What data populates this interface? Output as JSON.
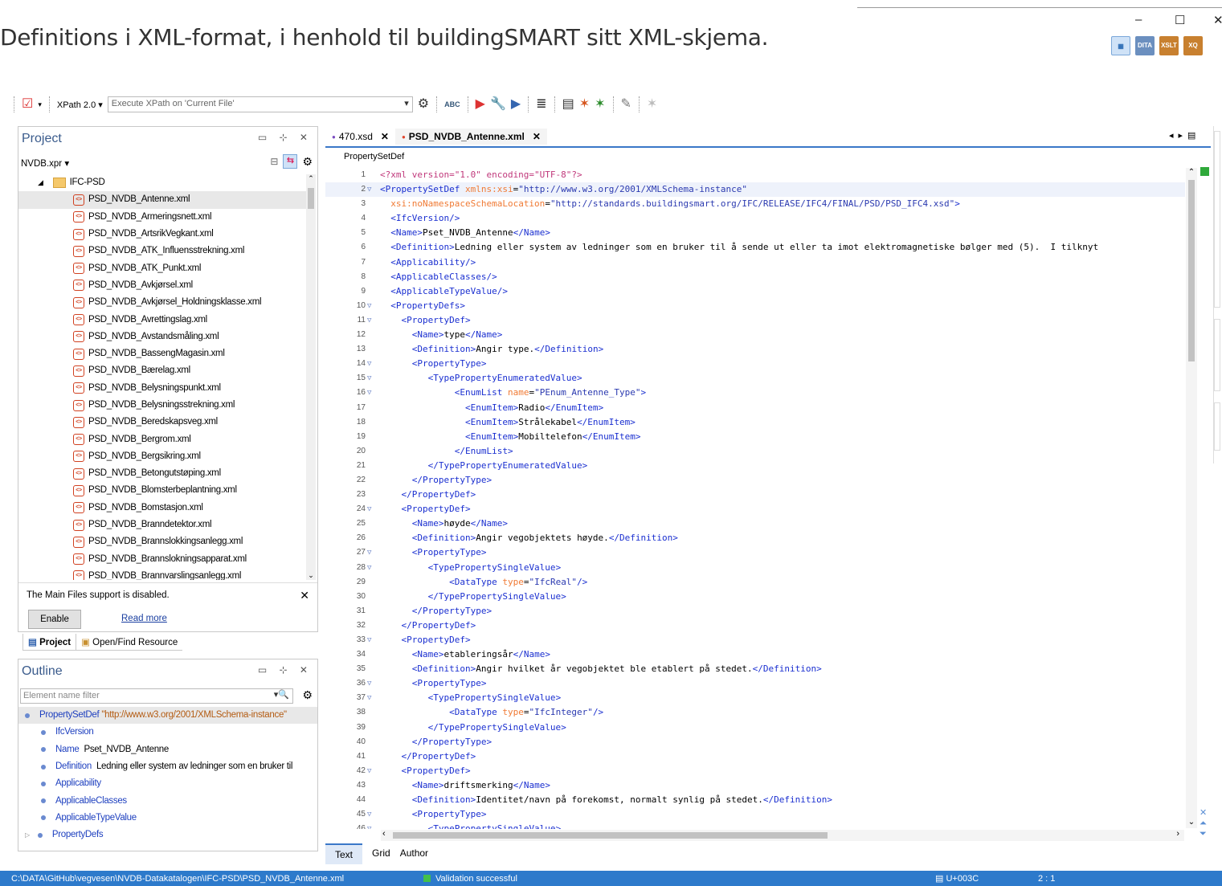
{
  "background_caption": "Definitions i XML-format, i henhold til buildingSMART sitt XML-skjema.",
  "window_controls": {
    "minimize": "–",
    "maximize": "☐",
    "close": "✕"
  },
  "top_icons": [
    "layout-icon",
    "DITA",
    "XSLT",
    "XQ",
    "more"
  ],
  "toolbar": {
    "xpath_version": "XPath 2.0",
    "xpath_placeholder": "Execute XPath on 'Current File'",
    "spellcheck_label": "ABC"
  },
  "project": {
    "title": "Project",
    "file": "NVDB.xpr",
    "folder": "IFC-PSD",
    "files": [
      "PSD_NVDB_Antenne.xml",
      "PSD_NVDB_Armeringsnett.xml",
      "PSD_NVDB_ArtsrikVegkant.xml",
      "PSD_NVDB_ATK_Influensstrekning.xml",
      "PSD_NVDB_ATK_Punkt.xml",
      "PSD_NVDB_Avkjørsel.xml",
      "PSD_NVDB_Avkjørsel_Holdningsklasse.xml",
      "PSD_NVDB_Avrettingslag.xml",
      "PSD_NVDB_Avstandsmåling.xml",
      "PSD_NVDB_BassengMagasin.xml",
      "PSD_NVDB_Bærelag.xml",
      "PSD_NVDB_Belysningspunkt.xml",
      "PSD_NVDB_Belysningsstrekning.xml",
      "PSD_NVDB_Beredskapsveg.xml",
      "PSD_NVDB_Bergrom.xml",
      "PSD_NVDB_Bergsikring.xml",
      "PSD_NVDB_Betongutstøping.xml",
      "PSD_NVDB_Blomsterbeplantning.xml",
      "PSD_NVDB_Bomstasjon.xml",
      "PSD_NVDB_Branndetektor.xml",
      "PSD_NVDB_Brannslokkingsanlegg.xml",
      "PSD_NVDB_Brannslokningsapparat.xml",
      "PSD_NVDB_Brannvarslingsanlegg.xml"
    ],
    "notice": "The Main Files support is disabled.",
    "enable_button": "Enable",
    "read_more": "Read more",
    "tab_project": "Project",
    "tab_open_find": "Open/Find Resource"
  },
  "outline": {
    "title": "Outline",
    "filter_placeholder": "Element name filter",
    "root": {
      "name": "PropertySetDef",
      "value": "\"http://www.w3.org/2001/XMLSchema-instance\""
    },
    "items": [
      {
        "name": "IfcVersion",
        "value": ""
      },
      {
        "name": "Name",
        "value": "Pset_NVDB_Antenne"
      },
      {
        "name": "Definition",
        "value": "Ledning eller system av ledninger som en bruker til"
      },
      {
        "name": "Applicability",
        "value": ""
      },
      {
        "name": "ApplicableClasses",
        "value": ""
      },
      {
        "name": "ApplicableTypeValue",
        "value": ""
      },
      {
        "name": "PropertyDefs",
        "value": ""
      }
    ]
  },
  "editor": {
    "tabs": [
      {
        "label": "470.xsd",
        "active": false
      },
      {
        "label": "PSD_NVDB_Antenne.xml",
        "active": true
      }
    ],
    "breadcrumb": "PropertySetDef",
    "bottom_tabs": [
      "Text",
      "Grid",
      "Author"
    ],
    "lines": [
      "<?xml version=\"1.0\" encoding=\"UTF-8\"?>",
      "<PropertySetDef xmlns:xsi=\"http://www.w3.org/2001/XMLSchema-instance\"",
      "  xsi:noNamespaceSchemaLocation=\"http://standards.buildingsmart.org/IFC/RELEASE/IFC4/FINAL/PSD/PSD_IFC4.xsd\">",
      "  <IfcVersion/>",
      "  <Name>Pset_NVDB_Antenne</Name>",
      "  <Definition>Ledning eller system av ledninger som en bruker til å sende ut eller ta imot elektromagnetiske bølger med (5).  I tilknyt",
      "  <Applicability/>",
      "  <ApplicableClasses/>",
      "  <ApplicableTypeValue/>",
      "  <PropertyDefs>",
      "    <PropertyDef>",
      "      <Name>type</Name>",
      "      <Definition>Angir type.</Definition>",
      "      <PropertyType>",
      "         <TypePropertyEnumeratedValue>",
      "              <EnumList name=\"PEnum_Antenne_Type\">",
      "                <EnumItem>Radio</EnumItem>",
      "                <EnumItem>Strålekabel</EnumItem>",
      "                <EnumItem>Mobiltelefon</EnumItem>",
      "              </EnumList>",
      "         </TypePropertyEnumeratedValue>",
      "      </PropertyType>",
      "    </PropertyDef>",
      "    <PropertyDef>",
      "      <Name>høyde</Name>",
      "      <Definition>Angir vegobjektets høyde.</Definition>",
      "      <PropertyType>",
      "         <TypePropertySingleValue>",
      "             <DataType type=\"IfcReal\"/>",
      "         </TypePropertySingleValue>",
      "      </PropertyType>",
      "    </PropertyDef>",
      "    <PropertyDef>",
      "      <Name>etableringsår</Name>",
      "      <Definition>Angir hvilket år vegobjektet ble etablert på stedet.</Definition>",
      "      <PropertyType>",
      "         <TypePropertySingleValue>",
      "             <DataType type=\"IfcInteger\"/>",
      "         </TypePropertySingleValue>",
      "      </PropertyType>",
      "    </PropertyDef>",
      "    <PropertyDef>",
      "      <Name>driftsmerking</Name>",
      "      <Definition>Identitet/navn på forekomst, normalt synlig på stedet.</Definition>",
      "      <PropertyType>",
      "         <TypePropertySingleValue>"
    ],
    "foldable_lines": [
      2,
      10,
      11,
      14,
      15,
      16,
      24,
      27,
      28,
      33,
      36,
      37,
      42,
      45,
      46
    ]
  },
  "status": {
    "path": "C:\\DATA\\GitHub\\vegvesen\\NVDB-Datakatalogen\\IFC-PSD\\PSD_NVDB_Antenne.xml",
    "validation": "Validation successful",
    "unicode": "U+003C",
    "position": "2 : 1"
  },
  "colors": {
    "status_bar": "#2d7acb",
    "tag": "#1a2fd0",
    "attr_name": "#f07a34",
    "attr_value": "#2b3ab0",
    "panel_title": "#3a5b8c"
  }
}
